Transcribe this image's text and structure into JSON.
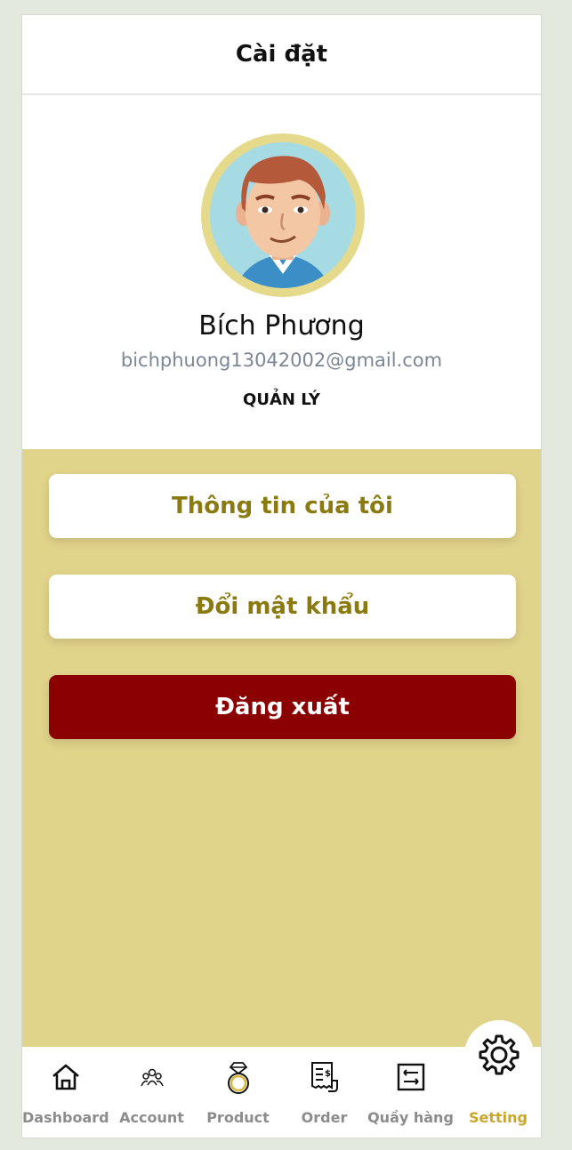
{
  "header": {
    "title": "Cài đặt"
  },
  "profile": {
    "name": "Bích Phương",
    "email": "bichphuong13042002@gmail.com",
    "role": "QUẢN LÝ"
  },
  "menu": {
    "my_info": "Thông tin của tôi",
    "change_password": "Đổi mật khẩu",
    "logout": "Đăng xuất"
  },
  "tabs": [
    {
      "label": "Dashboard",
      "icon": "home-icon"
    },
    {
      "label": "Account",
      "icon": "users-icon"
    },
    {
      "label": "Product",
      "icon": "ring-icon"
    },
    {
      "label": "Order",
      "icon": "receipt-icon"
    },
    {
      "label": "Quầy hàng",
      "icon": "counter-icon"
    },
    {
      "label": "Setting",
      "icon": "gear-icon",
      "active": true
    }
  ],
  "colors": {
    "accent": "#c9a62a",
    "menu_background": "#e0d38a",
    "button_text": "#8b7a10",
    "logout": "#8b0000"
  }
}
